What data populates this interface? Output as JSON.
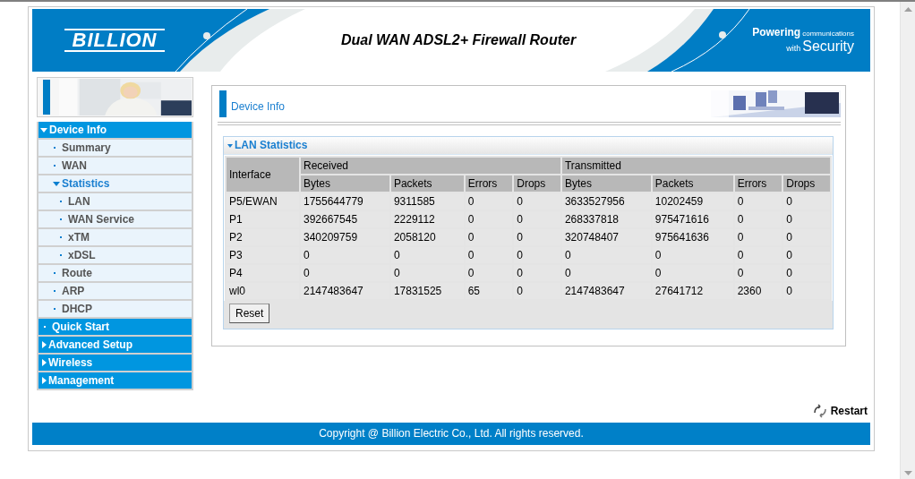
{
  "header": {
    "logo": "BILLION",
    "title": "Dual WAN ADSL2+ Firewall Router",
    "tagline_top": "Powering",
    "tagline_small": "communications",
    "tagline_with": "with",
    "tagline_big": "Security"
  },
  "sidebar": {
    "items": [
      {
        "label": "Device Info",
        "expanded": true,
        "children": [
          {
            "label": "Summary"
          },
          {
            "label": "WAN"
          },
          {
            "label": "Statistics",
            "expanded": true,
            "children": [
              {
                "label": "LAN"
              },
              {
                "label": "WAN Service"
              },
              {
                "label": "xTM"
              },
              {
                "label": "xDSL"
              }
            ]
          },
          {
            "label": "Route"
          },
          {
            "label": "ARP"
          },
          {
            "label": "DHCP"
          }
        ]
      },
      {
        "label": "Quick Start"
      },
      {
        "label": "Advanced Setup",
        "expanded": false
      },
      {
        "label": "Wireless",
        "expanded": false
      },
      {
        "label": "Management",
        "expanded": false
      }
    ]
  },
  "page": {
    "title": "Device Info"
  },
  "section": {
    "title": "LAN Statistics",
    "expanded": true
  },
  "table": {
    "first_column": "Interface",
    "groups": [
      {
        "label": "Received",
        "columns": [
          "Bytes",
          "Packets",
          "Errors",
          "Drops"
        ]
      },
      {
        "label": "Transmitted",
        "columns": [
          "Bytes",
          "Packets",
          "Errors",
          "Drops"
        ]
      }
    ],
    "rows": [
      [
        "P5/EWAN",
        "1755644779",
        "9311585",
        "0",
        "0",
        "3633527956",
        "10202459",
        "0",
        "0"
      ],
      [
        "P1",
        "392667545",
        "2229112",
        "0",
        "0",
        "268337818",
        "975471616",
        "0",
        "0"
      ],
      [
        "P2",
        "340209759",
        "2058120",
        "0",
        "0",
        "320748407",
        "975641636",
        "0",
        "0"
      ],
      [
        "P3",
        "0",
        "0",
        "0",
        "0",
        "0",
        "0",
        "0",
        "0"
      ],
      [
        "P4",
        "0",
        "0",
        "0",
        "0",
        "0",
        "0",
        "0",
        "0"
      ],
      [
        "wl0",
        "2147483647",
        "17831525",
        "65",
        "0",
        "2147483647",
        "27641712",
        "2360",
        "0"
      ]
    ]
  },
  "buttons": {
    "reset": "Reset",
    "restart": "Restart"
  },
  "footer": "Copyright @ Billion Electric Co., Ltd. All rights reserved."
}
